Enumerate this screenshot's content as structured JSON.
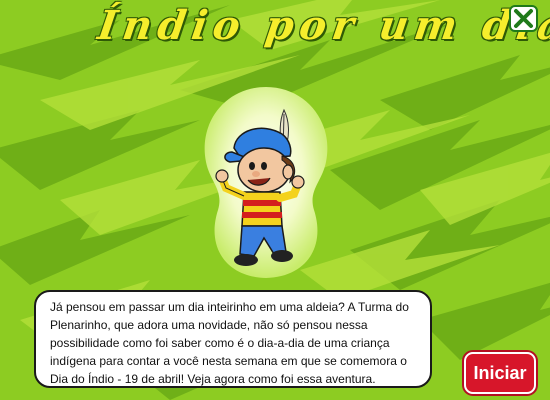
{
  "title": "Índio por um dia!",
  "close_icon": "close-x-icon",
  "intro_text": "Já pensou em passar um dia inteirinho em uma aldeia? A Turma do Plenarinho, que adora uma novidade, não só pensou nessa possibilidade como foi saber como é o dia-a-dia de uma criança indígena para contar a você nesta semana em que se comemora o Dia do Índio - 19 de abril! Veja agora como foi essa aventura.",
  "start_label": "Iniciar",
  "colors": {
    "background": "#8dcc22",
    "grass_dark": "#6aaa16",
    "grass_light": "#b4e03a",
    "title": "#f6ee2c",
    "close_border": "#1f7a1a",
    "start_button": "#d7162a"
  },
  "character": "cartoon-boy-with-feather-cap"
}
